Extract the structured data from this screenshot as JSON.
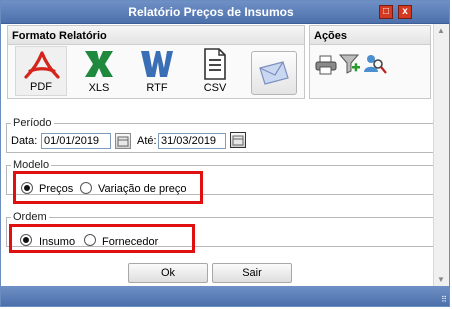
{
  "window": {
    "title": "Relatório Preços de Insumos",
    "max_glyph": "□",
    "close_glyph": "x"
  },
  "formato": {
    "heading": "Formato Relatório",
    "buttons": [
      {
        "label": "PDF",
        "icon": "pdf-icon"
      },
      {
        "label": "XLS",
        "icon": "excel-icon"
      },
      {
        "label": "RTF",
        "icon": "word-icon"
      },
      {
        "label": "CSV",
        "icon": "csv-document-icon"
      },
      {
        "label": "",
        "icon": "email-envelope-icon"
      }
    ]
  },
  "acoes": {
    "heading": "Ações",
    "icons": [
      "printer-icon",
      "filter-add-icon",
      "search-user-icon"
    ]
  },
  "periodo": {
    "legend": "Período",
    "data_label": "Data:",
    "data_value": "01/01/2019",
    "ate_label": "Até:",
    "ate_value": "31/03/2019"
  },
  "modelo": {
    "legend": "Modelo",
    "opt1": "Preços",
    "opt2": "Variação de preço",
    "selected": "Preços"
  },
  "ordem": {
    "legend": "Ordem",
    "opt1": "Insumo",
    "opt2": "Fornecedor",
    "selected": "Insumo"
  },
  "buttons": {
    "ok": "Ok",
    "sair": "Sair"
  },
  "colors": {
    "titlebar": "#5b7fba",
    "highlight": "#e01010",
    "pdf": "#d4241c",
    "xls": "#1f8a3e",
    "rtf": "#3a6fb6"
  }
}
